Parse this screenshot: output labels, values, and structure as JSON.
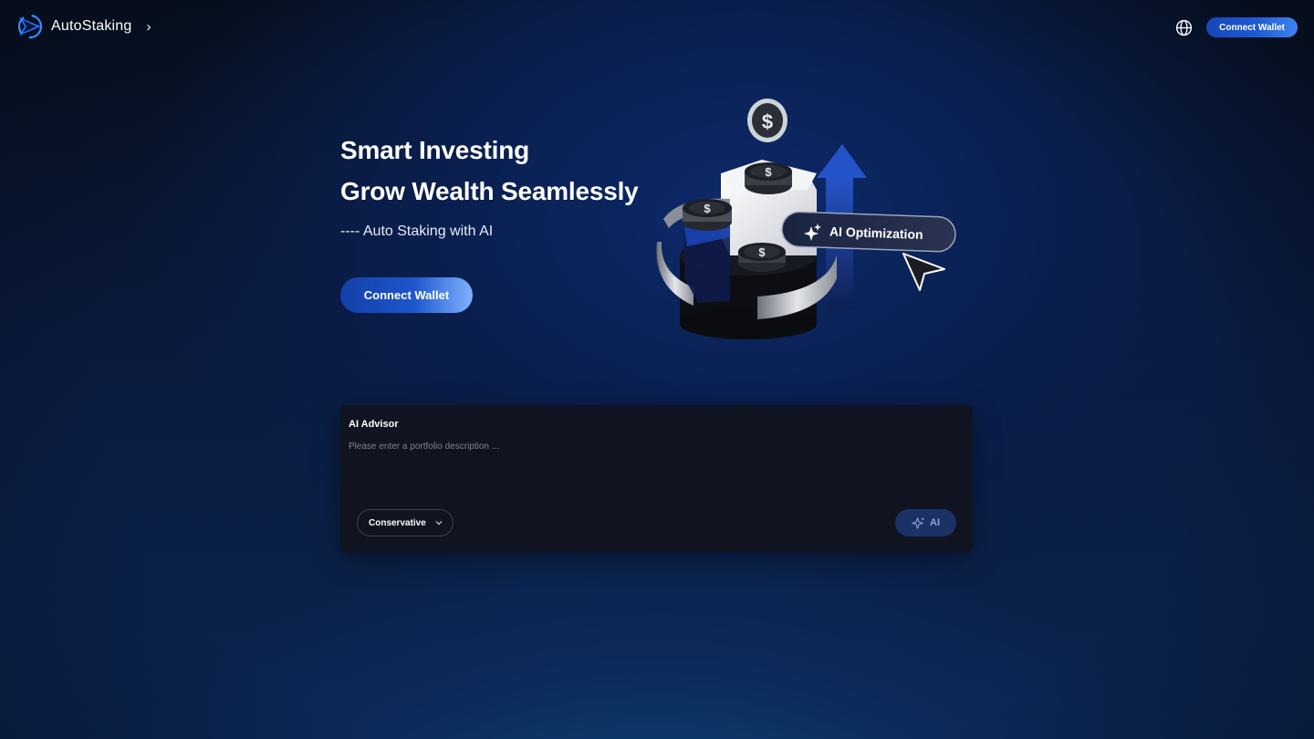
{
  "header": {
    "brand_name": "AutoStaking",
    "brand_chevron": "›",
    "language_icon": "globe-icon",
    "connect_wallet_label": "Connect Wallet"
  },
  "hero": {
    "title_line1": "Smart Investing",
    "title_line2": "Grow Wealth Seamlessly",
    "subtitle": "---- Auto Staking with AI",
    "connect_wallet_label": "Connect Wallet",
    "illustration_badge": "AI Optimization",
    "coin_symbol": "$"
  },
  "advisor": {
    "title": "AI Advisor",
    "input_value": "",
    "input_placeholder": "Please enter a portfolio description ...",
    "risk_selected": "Conservative",
    "ai_button_label": "AI"
  },
  "colors": {
    "accent": "#1d5bd2",
    "accent_light": "#7fb2ff",
    "panel": "#0f1420",
    "ai_button": "#1c3266"
  }
}
